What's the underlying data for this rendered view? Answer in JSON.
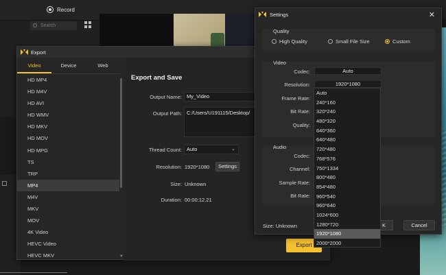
{
  "background": {
    "record_label": "Record",
    "search_placeholder": "Search"
  },
  "export_window": {
    "title": "Export",
    "tabs": [
      "Video",
      "Device",
      "Web"
    ],
    "active_tab": "Video",
    "formats": [
      "HD MP4",
      "HD M4V",
      "HD AVI",
      "HD WMV",
      "HD MKV",
      "HD MOV",
      "HD MPG",
      "TS",
      "TRP",
      "MP4",
      "M4V",
      "MKV",
      "MOV",
      "4K Video",
      "HEVC Video",
      "HEVC MKV"
    ],
    "selected_format": "MP4",
    "heading": "Export and Save",
    "output_name_label": "Output Name:",
    "output_name_value": "My_Video",
    "output_path_label": "Output Path:",
    "output_path_value": "C:/Users/U191115/Desktop/",
    "thread_count_label": "Thread Count:",
    "thread_count_value": "Auto",
    "resolution_label": "Resolution:",
    "resolution_value": "1920*1080",
    "settings_button": "Settings",
    "size_label": "Size:",
    "size_value": "Unknown",
    "duration_label": "Duration:",
    "duration_value": "00:00:12.21",
    "export_button": "Export"
  },
  "settings_window": {
    "title": "Settings",
    "quality_group": "Quality",
    "quality_options": [
      "High Quality",
      "Small File Size",
      "Custom"
    ],
    "quality_selected": "Custom",
    "video_group": "Video",
    "codec_label": "Codec:",
    "codec_value": "Auto",
    "resolution_label": "Resolution:",
    "resolution_value": "1920*1080",
    "frame_rate_label": "Frame Rate:",
    "bit_rate_label": "Bit Rate:",
    "quality_label": "Quality:",
    "audio_group": "Audio",
    "audio_codec_label": "Codec:",
    "channel_label": "Channel:",
    "sample_rate_label": "Sample Rate:",
    "audio_bit_rate_label": "Bit Rate:",
    "size_text": "Size: Unknown",
    "ok_button": "K",
    "cancel_button": "Cancel",
    "resolution_options": [
      "Auto",
      "240*160",
      "320*240",
      "480*320",
      "640*360",
      "640*480",
      "720*480",
      "768*576",
      "750*1334",
      "800*480",
      "854*480",
      "960*540",
      "960*640",
      "1024*600",
      "1280*720",
      "1920*1080",
      "2000*2000"
    ],
    "resolution_option_selected": "1920*1080"
  },
  "colors": {
    "accent": "#f5c12e",
    "background": "#1a1a1a",
    "panel": "#262626"
  }
}
